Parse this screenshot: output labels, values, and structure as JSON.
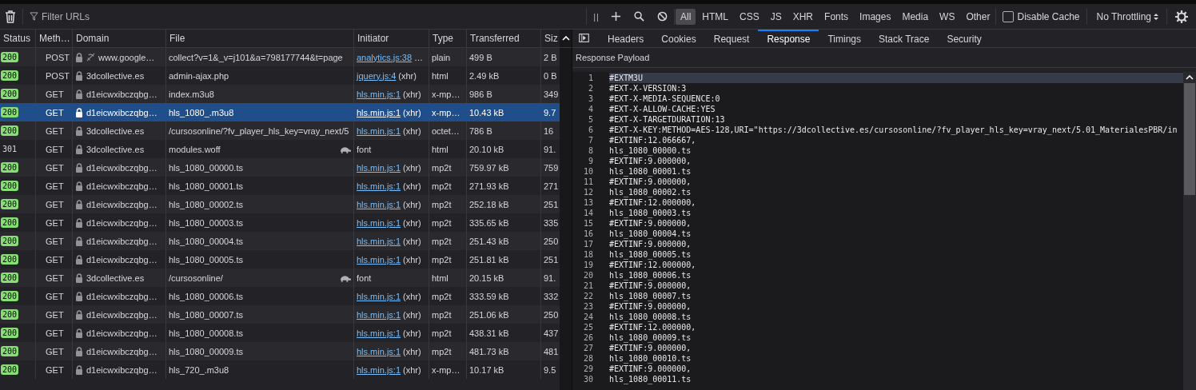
{
  "toolbar": {
    "filter_placeholder": "Filter URLs",
    "pause_icon_text": "| |",
    "filters": [
      {
        "label": "All",
        "selected": true
      },
      {
        "label": "HTML",
        "selected": false
      },
      {
        "label": "CSS",
        "selected": false
      },
      {
        "label": "JS",
        "selected": false
      },
      {
        "label": "XHR",
        "selected": false
      },
      {
        "label": "Fonts",
        "selected": false
      },
      {
        "label": "Images",
        "selected": false
      },
      {
        "label": "Media",
        "selected": false
      },
      {
        "label": "WS",
        "selected": false
      },
      {
        "label": "Other",
        "selected": false
      }
    ],
    "disable_cache": {
      "label": "Disable Cache",
      "checked": false
    },
    "throttling": "No Throttling"
  },
  "table": {
    "columns": [
      "Status",
      "Meth…",
      "Domain",
      "File",
      "Initiator",
      "Type",
      "Transferred",
      "Siz"
    ],
    "rows": [
      {
        "status": "200",
        "badge": true,
        "method": "POST",
        "secure": true,
        "tracker": true,
        "domain": "www.google…",
        "file": "collect?v=1&_v=j101&a=798177744&t=page",
        "throttled": false,
        "initiator": "analytics.js:38",
        "initiator_link": true,
        "initiator_suffix": "…",
        "type": "plain",
        "transferred": "499 B",
        "size": "2 B",
        "selected": false
      },
      {
        "status": "200",
        "badge": true,
        "method": "POST",
        "secure": true,
        "tracker": false,
        "domain": "3dcollective.es",
        "file": "admin-ajax.php",
        "throttled": false,
        "initiator": "jquery.js:4",
        "initiator_link": true,
        "initiator_suffix": "(xhr)",
        "type": "html",
        "transferred": "2.49 kB",
        "size": "0 B",
        "selected": false
      },
      {
        "status": "200",
        "badge": true,
        "method": "GET",
        "secure": true,
        "tracker": false,
        "domain": "d1eicwxibczqbg…",
        "file": "index.m3u8",
        "throttled": false,
        "initiator": "hls.min.js:1",
        "initiator_link": true,
        "initiator_suffix": "(xhr)",
        "type": "x-mp…",
        "transferred": "986 B",
        "size": "349",
        "selected": false
      },
      {
        "status": "200",
        "badge": true,
        "method": "GET",
        "secure": true,
        "tracker": false,
        "domain": "d1eicwxibczqbg…",
        "file": "hls_1080_.m3u8",
        "throttled": false,
        "initiator": "hls.min.js:1",
        "initiator_link": true,
        "initiator_suffix": "(xhr)",
        "type": "x-mp…",
        "transferred": "10.43 kB",
        "size": "9.7",
        "selected": true
      },
      {
        "status": "200",
        "badge": true,
        "method": "GET",
        "secure": true,
        "tracker": false,
        "domain": "3dcollective.es",
        "file": "/cursosonline/?fv_player_hls_key=vray_next/5",
        "throttled": false,
        "initiator": "hls.min.js:1",
        "initiator_link": true,
        "initiator_suffix": "(xhr)",
        "type": "octet…",
        "transferred": "786 B",
        "size": "16",
        "selected": false
      },
      {
        "status": "301",
        "badge": false,
        "method": "GET",
        "secure": true,
        "tracker": false,
        "domain": "3dcollective.es",
        "file": "modules.woff",
        "throttled": true,
        "initiator": "font",
        "initiator_link": false,
        "initiator_suffix": "",
        "type": "html",
        "transferred": "20.10 kB",
        "size": "91.",
        "selected": false
      },
      {
        "status": "200",
        "badge": true,
        "method": "GET",
        "secure": true,
        "tracker": false,
        "domain": "d1eicwxibczqbg…",
        "file": "hls_1080_00000.ts",
        "throttled": false,
        "initiator": "hls.min.js:1",
        "initiator_link": true,
        "initiator_suffix": "(xhr)",
        "type": "mp2t",
        "transferred": "759.97 kB",
        "size": "759",
        "selected": false
      },
      {
        "status": "200",
        "badge": true,
        "method": "GET",
        "secure": true,
        "tracker": false,
        "domain": "d1eicwxibczqbg…",
        "file": "hls_1080_00001.ts",
        "throttled": false,
        "initiator": "hls.min.js:1",
        "initiator_link": true,
        "initiator_suffix": "(xhr)",
        "type": "mp2t",
        "transferred": "271.93 kB",
        "size": "271",
        "selected": false
      },
      {
        "status": "200",
        "badge": true,
        "method": "GET",
        "secure": true,
        "tracker": false,
        "domain": "d1eicwxibczqbg…",
        "file": "hls_1080_00002.ts",
        "throttled": false,
        "initiator": "hls.min.js:1",
        "initiator_link": true,
        "initiator_suffix": "(xhr)",
        "type": "mp2t",
        "transferred": "252.18 kB",
        "size": "251",
        "selected": false
      },
      {
        "status": "200",
        "badge": true,
        "method": "GET",
        "secure": true,
        "tracker": false,
        "domain": "d1eicwxibczqbg…",
        "file": "hls_1080_00003.ts",
        "throttled": false,
        "initiator": "hls.min.js:1",
        "initiator_link": true,
        "initiator_suffix": "(xhr)",
        "type": "mp2t",
        "transferred": "335.65 kB",
        "size": "335",
        "selected": false
      },
      {
        "status": "200",
        "badge": true,
        "method": "GET",
        "secure": true,
        "tracker": false,
        "domain": "d1eicwxibczqbg…",
        "file": "hls_1080_00004.ts",
        "throttled": false,
        "initiator": "hls.min.js:1",
        "initiator_link": true,
        "initiator_suffix": "(xhr)",
        "type": "mp2t",
        "transferred": "251.43 kB",
        "size": "250",
        "selected": false
      },
      {
        "status": "200",
        "badge": true,
        "method": "GET",
        "secure": true,
        "tracker": false,
        "domain": "d1eicwxibczqbg…",
        "file": "hls_1080_00005.ts",
        "throttled": false,
        "initiator": "hls.min.js:1",
        "initiator_link": true,
        "initiator_suffix": "(xhr)",
        "type": "mp2t",
        "transferred": "251.81 kB",
        "size": "251",
        "selected": false
      },
      {
        "status": "200",
        "badge": true,
        "method": "GET",
        "secure": true,
        "tracker": false,
        "domain": "3dcollective.es",
        "file": "/cursosonline/",
        "throttled": true,
        "initiator": "font",
        "initiator_link": false,
        "initiator_suffix": "",
        "type": "html",
        "transferred": "20.15 kB",
        "size": "91.",
        "selected": false
      },
      {
        "status": "200",
        "badge": true,
        "method": "GET",
        "secure": true,
        "tracker": false,
        "domain": "d1eicwxibczqbg…",
        "file": "hls_1080_00006.ts",
        "throttled": false,
        "initiator": "hls.min.js:1",
        "initiator_link": true,
        "initiator_suffix": "(xhr)",
        "type": "mp2t",
        "transferred": "333.59 kB",
        "size": "332",
        "selected": false
      },
      {
        "status": "200",
        "badge": true,
        "method": "GET",
        "secure": true,
        "tracker": false,
        "domain": "d1eicwxibczqbg…",
        "file": "hls_1080_00007.ts",
        "throttled": false,
        "initiator": "hls.min.js:1",
        "initiator_link": true,
        "initiator_suffix": "(xhr)",
        "type": "mp2t",
        "transferred": "251.06 kB",
        "size": "250",
        "selected": false
      },
      {
        "status": "200",
        "badge": true,
        "method": "GET",
        "secure": true,
        "tracker": false,
        "domain": "d1eicwxibczqbg…",
        "file": "hls_1080_00008.ts",
        "throttled": false,
        "initiator": "hls.min.js:1",
        "initiator_link": true,
        "initiator_suffix": "(xhr)",
        "type": "mp2t",
        "transferred": "438.31 kB",
        "size": "437",
        "selected": false
      },
      {
        "status": "200",
        "badge": true,
        "method": "GET",
        "secure": true,
        "tracker": false,
        "domain": "d1eicwxibczqbg…",
        "file": "hls_1080_00009.ts",
        "throttled": false,
        "initiator": "hls.min.js:1",
        "initiator_link": true,
        "initiator_suffix": "(xhr)",
        "type": "mp2t",
        "transferred": "481.73 kB",
        "size": "481",
        "selected": false
      },
      {
        "status": "200",
        "badge": true,
        "method": "GET",
        "secure": true,
        "tracker": false,
        "domain": "d1eicwxibczqbg…",
        "file": "hls_720_.m3u8",
        "throttled": false,
        "initiator": "hls.min.js:1",
        "initiator_link": true,
        "initiator_suffix": "(xhr)",
        "type": "x-mp…",
        "transferred": "10.17 kB",
        "size": "9.5",
        "selected": false
      }
    ]
  },
  "details": {
    "tabs": [
      {
        "label": "Headers",
        "selected": false
      },
      {
        "label": "Cookies",
        "selected": false
      },
      {
        "label": "Request",
        "selected": false
      },
      {
        "label": "Response",
        "selected": true
      },
      {
        "label": "Timings",
        "selected": false
      },
      {
        "label": "Stack Trace",
        "selected": false
      },
      {
        "label": "Security",
        "selected": false
      }
    ],
    "section_title": "Response Payload",
    "lines": [
      {
        "n": "1",
        "text": "#EXTM3U",
        "selected": true
      },
      {
        "n": "2",
        "text": "#EXT-X-VERSION:3",
        "selected": false
      },
      {
        "n": "3",
        "text": "#EXT-X-MEDIA-SEQUENCE:0",
        "selected": false
      },
      {
        "n": "4",
        "text": "#EXT-X-ALLOW-CACHE:YES",
        "selected": false
      },
      {
        "n": "5",
        "text": "#EXT-X-TARGETDURATION:13",
        "selected": false
      },
      {
        "n": "6",
        "text": "#EXT-X-KEY:METHOD=AES-128,URI=\"https://3dcollective.es/cursosonline/?fv_player_hls_key=vray_next/5.01_MaterialesPBR/in",
        "selected": false
      },
      {
        "n": "7",
        "text": "#EXTINF:12.066667,",
        "selected": false
      },
      {
        "n": "8",
        "text": "hls_1080_00000.ts",
        "selected": false
      },
      {
        "n": "9",
        "text": "#EXTINF:9.000000,",
        "selected": false
      },
      {
        "n": "10",
        "text": "hls_1080_00001.ts",
        "selected": false
      },
      {
        "n": "11",
        "text": "#EXTINF:9.000000,",
        "selected": false
      },
      {
        "n": "12",
        "text": "hls_1080_00002.ts",
        "selected": false
      },
      {
        "n": "13",
        "text": "#EXTINF:12.000000,",
        "selected": false
      },
      {
        "n": "14",
        "text": "hls_1080_00003.ts",
        "selected": false
      },
      {
        "n": "15",
        "text": "#EXTINF:9.000000,",
        "selected": false
      },
      {
        "n": "16",
        "text": "hls_1080_00004.ts",
        "selected": false
      },
      {
        "n": "17",
        "text": "#EXTINF:9.000000,",
        "selected": false
      },
      {
        "n": "18",
        "text": "hls_1080_00005.ts",
        "selected": false
      },
      {
        "n": "19",
        "text": "#EXTINF:12.000000,",
        "selected": false
      },
      {
        "n": "20",
        "text": "hls_1080_00006.ts",
        "selected": false
      },
      {
        "n": "21",
        "text": "#EXTINF:9.000000,",
        "selected": false
      },
      {
        "n": "22",
        "text": "hls_1080_00007.ts",
        "selected": false
      },
      {
        "n": "23",
        "text": "#EXTINF:9.000000,",
        "selected": false
      },
      {
        "n": "24",
        "text": "hls_1080_00008.ts",
        "selected": false
      },
      {
        "n": "25",
        "text": "#EXTINF:12.000000,",
        "selected": false
      },
      {
        "n": "26",
        "text": "hls_1080_00009.ts",
        "selected": false
      },
      {
        "n": "27",
        "text": "#EXTINF:9.000000,",
        "selected": false
      },
      {
        "n": "28",
        "text": "hls_1080_00010.ts",
        "selected": false
      },
      {
        "n": "29",
        "text": "#EXTINF:9.000000,",
        "selected": false
      },
      {
        "n": "30",
        "text": "hls_1080_00011.ts",
        "selected": false
      }
    ]
  }
}
